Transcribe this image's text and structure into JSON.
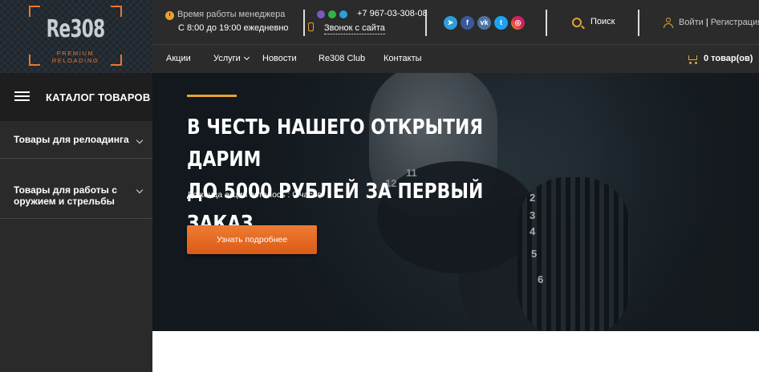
{
  "brand": {
    "logo_text": "Re308",
    "logo_subtitle": "PREMIUM RELOADING",
    "accent_color": "#e8772e",
    "header_background": "#2b2b2b"
  },
  "header": {
    "work_hours_label": "Время работы менеджера",
    "work_hours_value": "С 8:00 до 19:00 ежедневно",
    "messengers": [
      "viber-icon",
      "whatsapp-icon",
      "telegram-icon"
    ],
    "phone": "+7 967-03-308-08",
    "callback_link": "Звонок с сайта",
    "social": [
      "telegram-icon",
      "facebook-icon",
      "vk-icon",
      "twitter-icon",
      "instagram-icon"
    ],
    "search_label": "Поиск",
    "login_label": "Войти",
    "separator": "|",
    "register_label": "Регистрация",
    "nav": [
      "Акции",
      "Услуги",
      "Новости",
      "Re308 Club",
      "Контакты"
    ],
    "cart_label": "0 товар(ов)"
  },
  "sidebar": {
    "title": "КАТАЛОГ ТОВАРОВ",
    "items": [
      {
        "label": "Товары для релоадинга"
      },
      {
        "label": "Товары для работы с оружием и стрельбы"
      }
    ]
  },
  "hero": {
    "title_line1": "В ЧЕСТЬ НАШЕГО ОТКРЫТИЯ ДАРИМ",
    "title_line2": "ДО 5000 РУБЛЕЙ ЗА ПЕРВЫЙ ЗАКАЗ",
    "timer_text": "До конца акции осталось : 0 часов",
    "cta_label": "Узнать подробнее",
    "scope_numbers": [
      "12",
      "11",
      "2",
      "3",
      "4",
      "5",
      "6"
    ],
    "cta_color": "#e6692a"
  }
}
